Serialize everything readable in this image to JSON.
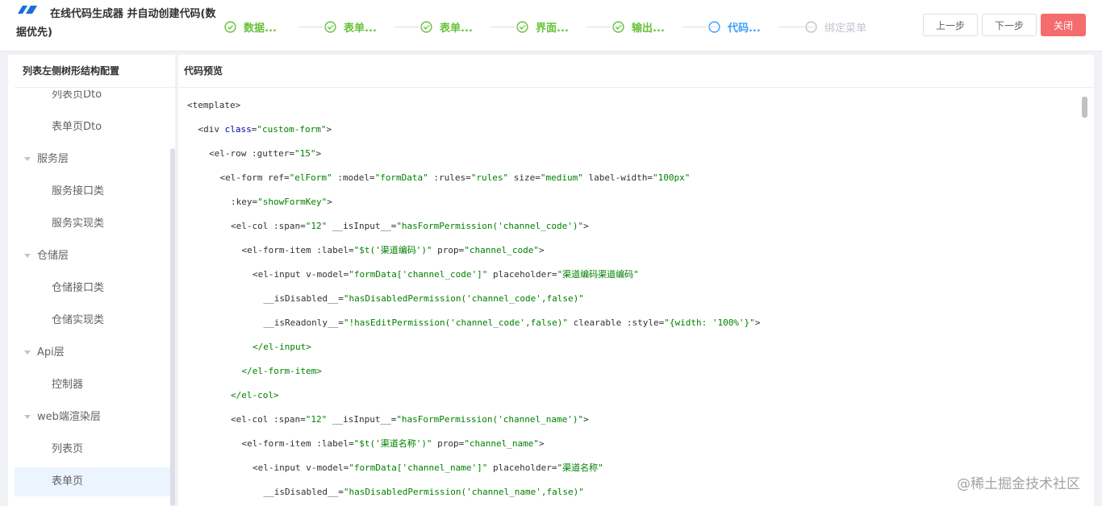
{
  "header": {
    "title_line1": "在线代码生成器 并自动创建代码(数",
    "title_line2": "据优先)",
    "steps": [
      {
        "label": "数据...",
        "state": "done"
      },
      {
        "label": "表单...",
        "state": "done"
      },
      {
        "label": "表单...",
        "state": "done"
      },
      {
        "label": "界面...",
        "state": "done"
      },
      {
        "label": "输出...",
        "state": "done"
      },
      {
        "label": "代码...",
        "state": "active"
      },
      {
        "label": "绑定菜单",
        "state": "pending"
      }
    ],
    "prev_label": "上一步",
    "next_label": "下一步",
    "close_label": "关闭"
  },
  "left": {
    "title": "列表左侧树形结构配置",
    "items": [
      {
        "label": "列表页Dto",
        "level": 2
      },
      {
        "label": "表单页Dto",
        "level": 2
      },
      {
        "label": "服务层",
        "level": 1
      },
      {
        "label": "服务接口类",
        "level": 2
      },
      {
        "label": "服务实现类",
        "level": 2
      },
      {
        "label": "仓储层",
        "level": 1
      },
      {
        "label": "仓储接口类",
        "level": 2
      },
      {
        "label": "仓储实现类",
        "level": 2
      },
      {
        "label": "Api层",
        "level": 1
      },
      {
        "label": "控制器",
        "level": 2
      },
      {
        "label": "web端渲染层",
        "level": 1
      },
      {
        "label": "列表页",
        "level": 2
      },
      {
        "label": "表单页",
        "level": 2,
        "selected": true
      }
    ]
  },
  "right": {
    "title": "代码预览",
    "code_lines": [
      {
        "indent": 0,
        "tokens": [
          [
            "p",
            "<template>"
          ]
        ]
      },
      {
        "indent": 1,
        "tokens": [
          [
            "p",
            "<div "
          ],
          [
            "k",
            "class"
          ],
          [
            "p",
            "="
          ],
          [
            "s",
            "\"custom-form\""
          ],
          [
            "p",
            ">"
          ]
        ]
      },
      {
        "indent": 2,
        "tokens": [
          [
            "p",
            "<el-row :gutter="
          ],
          [
            "s",
            "\"15\""
          ],
          [
            "p",
            ">"
          ]
        ]
      },
      {
        "indent": 3,
        "tokens": [
          [
            "p",
            "<el-form ref="
          ],
          [
            "s",
            "\"elForm\""
          ],
          [
            "p",
            " :model="
          ],
          [
            "s",
            "\"formData\""
          ],
          [
            "p",
            " :rules="
          ],
          [
            "s",
            "\"rules\""
          ],
          [
            "p",
            " size="
          ],
          [
            "s",
            "\"medium\""
          ],
          [
            "p",
            " label-width="
          ],
          [
            "s",
            "\"100px\""
          ]
        ]
      },
      {
        "indent": 4,
        "tokens": [
          [
            "p",
            ":key="
          ],
          [
            "s",
            "\"showFormKey\""
          ],
          [
            "p",
            ">"
          ]
        ]
      },
      {
        "indent": 4,
        "tokens": [
          [
            "p",
            "<el-col :span="
          ],
          [
            "s",
            "\"12\""
          ],
          [
            "p",
            " __isInput__="
          ],
          [
            "s",
            "\"hasFormPermission('channel_code')\""
          ],
          [
            "p",
            ">"
          ]
        ]
      },
      {
        "indent": 5,
        "tokens": [
          [
            "p",
            "<el-form-item :label="
          ],
          [
            "s",
            "\"$t('渠道编码')\""
          ],
          [
            "p",
            " prop="
          ],
          [
            "s",
            "\"channel_code\""
          ],
          [
            "p",
            ">"
          ]
        ]
      },
      {
        "indent": 6,
        "tokens": [
          [
            "p",
            "<el-input v-model="
          ],
          [
            "s",
            "\"formData['channel_code']\""
          ],
          [
            "p",
            " placeholder="
          ],
          [
            "s",
            "\"渠道编码渠道编码\""
          ]
        ]
      },
      {
        "indent": 7,
        "tokens": [
          [
            "p",
            "__isDisabled__="
          ],
          [
            "s",
            "\"hasDisabledPermission('channel_code',false)\""
          ]
        ]
      },
      {
        "indent": 7,
        "tokens": [
          [
            "p",
            "__isReadonly__="
          ],
          [
            "s",
            "\"!hasEditPermission('channel_code',false)\""
          ],
          [
            "p",
            " clearable :style="
          ],
          [
            "s",
            "\"{width: '100%'}\""
          ],
          [
            "p",
            ">"
          ]
        ]
      },
      {
        "indent": 6,
        "tokens": [
          [
            "s",
            "</el-input>"
          ]
        ]
      },
      {
        "indent": 5,
        "tokens": [
          [
            "s",
            "</el-form-item>"
          ]
        ]
      },
      {
        "indent": 4,
        "tokens": [
          [
            "s",
            "</el-col>"
          ]
        ]
      },
      {
        "indent": 4,
        "tokens": [
          [
            "p",
            "<el-col :span="
          ],
          [
            "s",
            "\"12\""
          ],
          [
            "p",
            " __isInput__="
          ],
          [
            "s",
            "\"hasFormPermission('channel_name')\""
          ],
          [
            "p",
            ">"
          ]
        ]
      },
      {
        "indent": 5,
        "tokens": [
          [
            "p",
            "<el-form-item :label="
          ],
          [
            "s",
            "\"$t('渠道名称')\""
          ],
          [
            "p",
            " prop="
          ],
          [
            "s",
            "\"channel_name\""
          ],
          [
            "p",
            ">"
          ]
        ]
      },
      {
        "indent": 6,
        "tokens": [
          [
            "p",
            "<el-input v-model="
          ],
          [
            "s",
            "\"formData['channel_name']\""
          ],
          [
            "p",
            " placeholder="
          ],
          [
            "s",
            "\"渠道名称\""
          ]
        ]
      },
      {
        "indent": 7,
        "tokens": [
          [
            "p",
            "__isDisabled__="
          ],
          [
            "s",
            "\"hasDisabledPermission('channel_name',false)\""
          ]
        ]
      }
    ]
  },
  "watermark": "@稀土掘金技术社区",
  "colors": {
    "done": "#67c23a",
    "active": "#409eff",
    "pending": "#c0c4cc",
    "danger": "#f56c6c"
  }
}
